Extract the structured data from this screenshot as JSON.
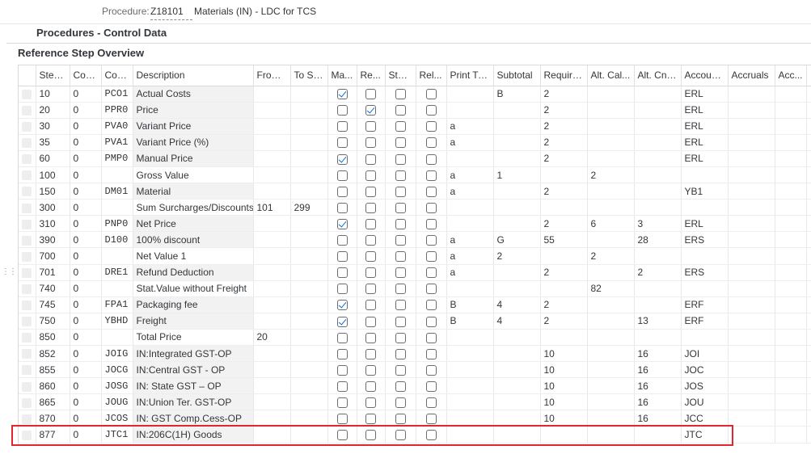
{
  "header": {
    "procedure_label": "Procedure:",
    "procedure_code": "Z18101",
    "procedure_desc": "Materials (IN) - LDC for TCS",
    "panel_title": "Procedures - Control Data",
    "section_title": "Reference Step Overview"
  },
  "columns": [
    "Step ...",
    "Cou...",
    "Con...",
    "Description",
    "From...",
    "To St...",
    "Ma...",
    "Re...",
    "Stat...",
    "Rel...",
    "Print Type",
    "Subtotal",
    "Require...",
    "Alt. Cal...",
    "Alt. Cnd...",
    "Accoun...",
    "Accruals",
    "Acc..."
  ],
  "rows": [
    {
      "step": "10",
      "counter": "0",
      "ctype": "PCO1",
      "desc": "Actual Costs",
      "from": "",
      "to": "",
      "man": true,
      "req": false,
      "stat": false,
      "rel": false,
      "print": "",
      "subtotal": "B",
      "requirement": "2",
      "altcalc": "",
      "altcnd": "",
      "account": "ERL",
      "accruals": "",
      "acc2": ""
    },
    {
      "step": "20",
      "counter": "0",
      "ctype": "PPR0",
      "desc": "Price",
      "from": "",
      "to": "",
      "man": false,
      "req": true,
      "stat": false,
      "rel": false,
      "print": "",
      "subtotal": "",
      "requirement": "2",
      "altcalc": "",
      "altcnd": "",
      "account": "ERL",
      "accruals": "",
      "acc2": ""
    },
    {
      "step": "30",
      "counter": "0",
      "ctype": "PVA0",
      "desc": "Variant Price",
      "from": "",
      "to": "",
      "man": false,
      "req": false,
      "stat": false,
      "rel": false,
      "print": "a",
      "subtotal": "",
      "requirement": "2",
      "altcalc": "",
      "altcnd": "",
      "account": "ERL",
      "accruals": "",
      "acc2": ""
    },
    {
      "step": "35",
      "counter": "0",
      "ctype": "PVA1",
      "desc": "Variant Price (%)",
      "from": "",
      "to": "",
      "man": false,
      "req": false,
      "stat": false,
      "rel": false,
      "print": "a",
      "subtotal": "",
      "requirement": "2",
      "altcalc": "",
      "altcnd": "",
      "account": "ERL",
      "accruals": "",
      "acc2": ""
    },
    {
      "step": "60",
      "counter": "0",
      "ctype": "PMP0",
      "desc": "Manual Price",
      "from": "",
      "to": "",
      "man": true,
      "req": false,
      "stat": false,
      "rel": false,
      "print": "",
      "subtotal": "",
      "requirement": "2",
      "altcalc": "",
      "altcnd": "",
      "account": "ERL",
      "accruals": "",
      "acc2": ""
    },
    {
      "step": "100",
      "counter": "0",
      "ctype": "",
      "desc": "Gross Value",
      "from": "",
      "to": "",
      "man": false,
      "req": false,
      "stat": false,
      "rel": false,
      "print": "a",
      "subtotal": "1",
      "requirement": "",
      "altcalc": "2",
      "altcnd": "",
      "account": "",
      "accruals": "",
      "acc2": ""
    },
    {
      "step": "150",
      "counter": "0",
      "ctype": "DM01",
      "desc": "Material",
      "from": "",
      "to": "",
      "man": false,
      "req": false,
      "stat": false,
      "rel": false,
      "print": "a",
      "subtotal": "",
      "requirement": "2",
      "altcalc": "",
      "altcnd": "",
      "account": "YB1",
      "accruals": "",
      "acc2": ""
    },
    {
      "step": "300",
      "counter": "0",
      "ctype": "",
      "desc": "Sum Surcharges/Discounts",
      "from": "101",
      "to": "299",
      "man": false,
      "req": false,
      "stat": false,
      "rel": false,
      "print": "",
      "subtotal": "",
      "requirement": "",
      "altcalc": "",
      "altcnd": "",
      "account": "",
      "accruals": "",
      "acc2": ""
    },
    {
      "step": "310",
      "counter": "0",
      "ctype": "PNP0",
      "desc": "Net Price",
      "from": "",
      "to": "",
      "man": true,
      "req": false,
      "stat": false,
      "rel": false,
      "print": "",
      "subtotal": "",
      "requirement": "2",
      "altcalc": "6",
      "altcnd": "3",
      "account": "ERL",
      "accruals": "",
      "acc2": ""
    },
    {
      "step": "390",
      "counter": "0",
      "ctype": "D100",
      "desc": "100% discount",
      "from": "",
      "to": "",
      "man": false,
      "req": false,
      "stat": false,
      "rel": false,
      "print": "a",
      "subtotal": "G",
      "requirement": "55",
      "altcalc": "",
      "altcnd": "28",
      "account": "ERS",
      "accruals": "",
      "acc2": ""
    },
    {
      "step": "700",
      "counter": "0",
      "ctype": "",
      "desc": "Net Value 1",
      "from": "",
      "to": "",
      "man": false,
      "req": false,
      "stat": false,
      "rel": false,
      "print": "a",
      "subtotal": "2",
      "requirement": "",
      "altcalc": "2",
      "altcnd": "",
      "account": "",
      "accruals": "",
      "acc2": ""
    },
    {
      "step": "701",
      "counter": "0",
      "ctype": "DRE1",
      "desc": "Refund Deduction",
      "from": "",
      "to": "",
      "man": false,
      "req": false,
      "stat": false,
      "rel": false,
      "print": "a",
      "subtotal": "",
      "requirement": "2",
      "altcalc": "",
      "altcnd": "2",
      "account": "ERS",
      "accruals": "",
      "acc2": ""
    },
    {
      "step": "740",
      "counter": "0",
      "ctype": "",
      "desc": "Stat.Value without Freight",
      "from": "",
      "to": "",
      "man": false,
      "req": false,
      "stat": false,
      "rel": false,
      "print": "",
      "subtotal": "",
      "requirement": "",
      "altcalc": "82",
      "altcnd": "",
      "account": "",
      "accruals": "",
      "acc2": ""
    },
    {
      "step": "745",
      "counter": "0",
      "ctype": "FPA1",
      "desc": "Packaging fee",
      "from": "",
      "to": "",
      "man": true,
      "req": false,
      "stat": false,
      "rel": false,
      "print": "B",
      "subtotal": "4",
      "requirement": "2",
      "altcalc": "",
      "altcnd": "",
      "account": "ERF",
      "accruals": "",
      "acc2": ""
    },
    {
      "step": "750",
      "counter": "0",
      "ctype": "YBHD",
      "desc": "Freight",
      "from": "",
      "to": "",
      "man": true,
      "req": false,
      "stat": false,
      "rel": false,
      "print": "B",
      "subtotal": "4",
      "requirement": "2",
      "altcalc": "",
      "altcnd": "13",
      "account": "ERF",
      "accruals": "",
      "acc2": ""
    },
    {
      "step": "850",
      "counter": "0",
      "ctype": "",
      "desc": "Total Price",
      "from": "20",
      "to": "",
      "man": false,
      "req": false,
      "stat": false,
      "rel": false,
      "print": "",
      "subtotal": "",
      "requirement": "",
      "altcalc": "",
      "altcnd": "",
      "account": "",
      "accruals": "",
      "acc2": ""
    },
    {
      "step": "852",
      "counter": "0",
      "ctype": "JOIG",
      "desc": "IN:Integrated GST-OP",
      "from": "",
      "to": "",
      "man": false,
      "req": false,
      "stat": false,
      "rel": false,
      "print": "",
      "subtotal": "",
      "requirement": "10",
      "altcalc": "",
      "altcnd": "16",
      "account": "JOI",
      "accruals": "",
      "acc2": ""
    },
    {
      "step": "855",
      "counter": "0",
      "ctype": "JOCG",
      "desc": "IN:Central GST - OP",
      "from": "",
      "to": "",
      "man": false,
      "req": false,
      "stat": false,
      "rel": false,
      "print": "",
      "subtotal": "",
      "requirement": "10",
      "altcalc": "",
      "altcnd": "16",
      "account": "JOC",
      "accruals": "",
      "acc2": ""
    },
    {
      "step": "860",
      "counter": "0",
      "ctype": "JOSG",
      "desc": "IN: State GST – OP",
      "from": "",
      "to": "",
      "man": false,
      "req": false,
      "stat": false,
      "rel": false,
      "print": "",
      "subtotal": "",
      "requirement": "10",
      "altcalc": "",
      "altcnd": "16",
      "account": "JOS",
      "accruals": "",
      "acc2": ""
    },
    {
      "step": "865",
      "counter": "0",
      "ctype": "JOUG",
      "desc": "IN:Union Ter. GST-OP",
      "from": "",
      "to": "",
      "man": false,
      "req": false,
      "stat": false,
      "rel": false,
      "print": "",
      "subtotal": "",
      "requirement": "10",
      "altcalc": "",
      "altcnd": "16",
      "account": "JOU",
      "accruals": "",
      "acc2": ""
    },
    {
      "step": "870",
      "counter": "0",
      "ctype": "JCOS",
      "desc": "IN: GST Comp.Cess-OP",
      "from": "",
      "to": "",
      "man": false,
      "req": false,
      "stat": false,
      "rel": false,
      "print": "",
      "subtotal": "",
      "requirement": "10",
      "altcalc": "",
      "altcnd": "16",
      "account": "JCC",
      "accruals": "",
      "acc2": ""
    },
    {
      "step": "877",
      "counter": "0",
      "ctype": "JTC1",
      "desc": "IN:206C(1H) Goods",
      "from": "",
      "to": "",
      "man": false,
      "req": false,
      "stat": false,
      "rel": false,
      "print": "",
      "subtotal": "",
      "requirement": "",
      "altcalc": "",
      "altcnd": "",
      "account": "JTC",
      "accruals": "",
      "acc2": ""
    }
  ],
  "colors": {
    "accent": "#0a6ed1",
    "highlight": "#e0262e"
  }
}
